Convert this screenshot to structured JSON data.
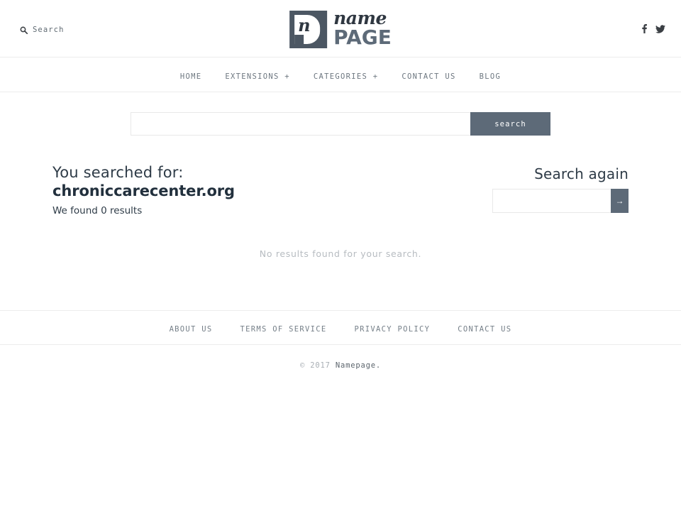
{
  "header": {
    "search_toggle": {
      "label": "Search",
      "icon": "search-icon"
    },
    "logo": {
      "mark_letter": "n",
      "script_word": "name",
      "bold_word": "PAGE"
    },
    "socials": [
      {
        "name": "facebook-icon",
        "label": "f"
      },
      {
        "name": "twitter-icon",
        "label": "t"
      }
    ]
  },
  "nav": {
    "items": [
      {
        "label": "HOME"
      },
      {
        "label": "EXTENSIONS +"
      },
      {
        "label": "CATEGORIES +"
      },
      {
        "label": "CONTACT US"
      },
      {
        "label": "BLOG"
      }
    ]
  },
  "main_search": {
    "value": "",
    "placeholder": "",
    "button_label": "search"
  },
  "results": {
    "lead": "You searched for:",
    "term": "chroniccarecenter.org",
    "count_text": "We found 0 results",
    "empty_message": "No results found for your search."
  },
  "search_again": {
    "heading": "Search again",
    "value": "",
    "placeholder": "",
    "button_label": "→"
  },
  "footer": {
    "links": [
      {
        "label": "ABOUT US"
      },
      {
        "label": "TERMS OF SERVICE"
      },
      {
        "label": "PRIVACY POLICY"
      },
      {
        "label": "CONTACT US"
      }
    ],
    "copyright_prefix": "© 2017 ",
    "copyright_brand": "Namepage."
  },
  "colors": {
    "accent": "#5d6a78",
    "heading": "#2e3b47",
    "muted": "#b7bcc1",
    "border": "#ececec"
  }
}
